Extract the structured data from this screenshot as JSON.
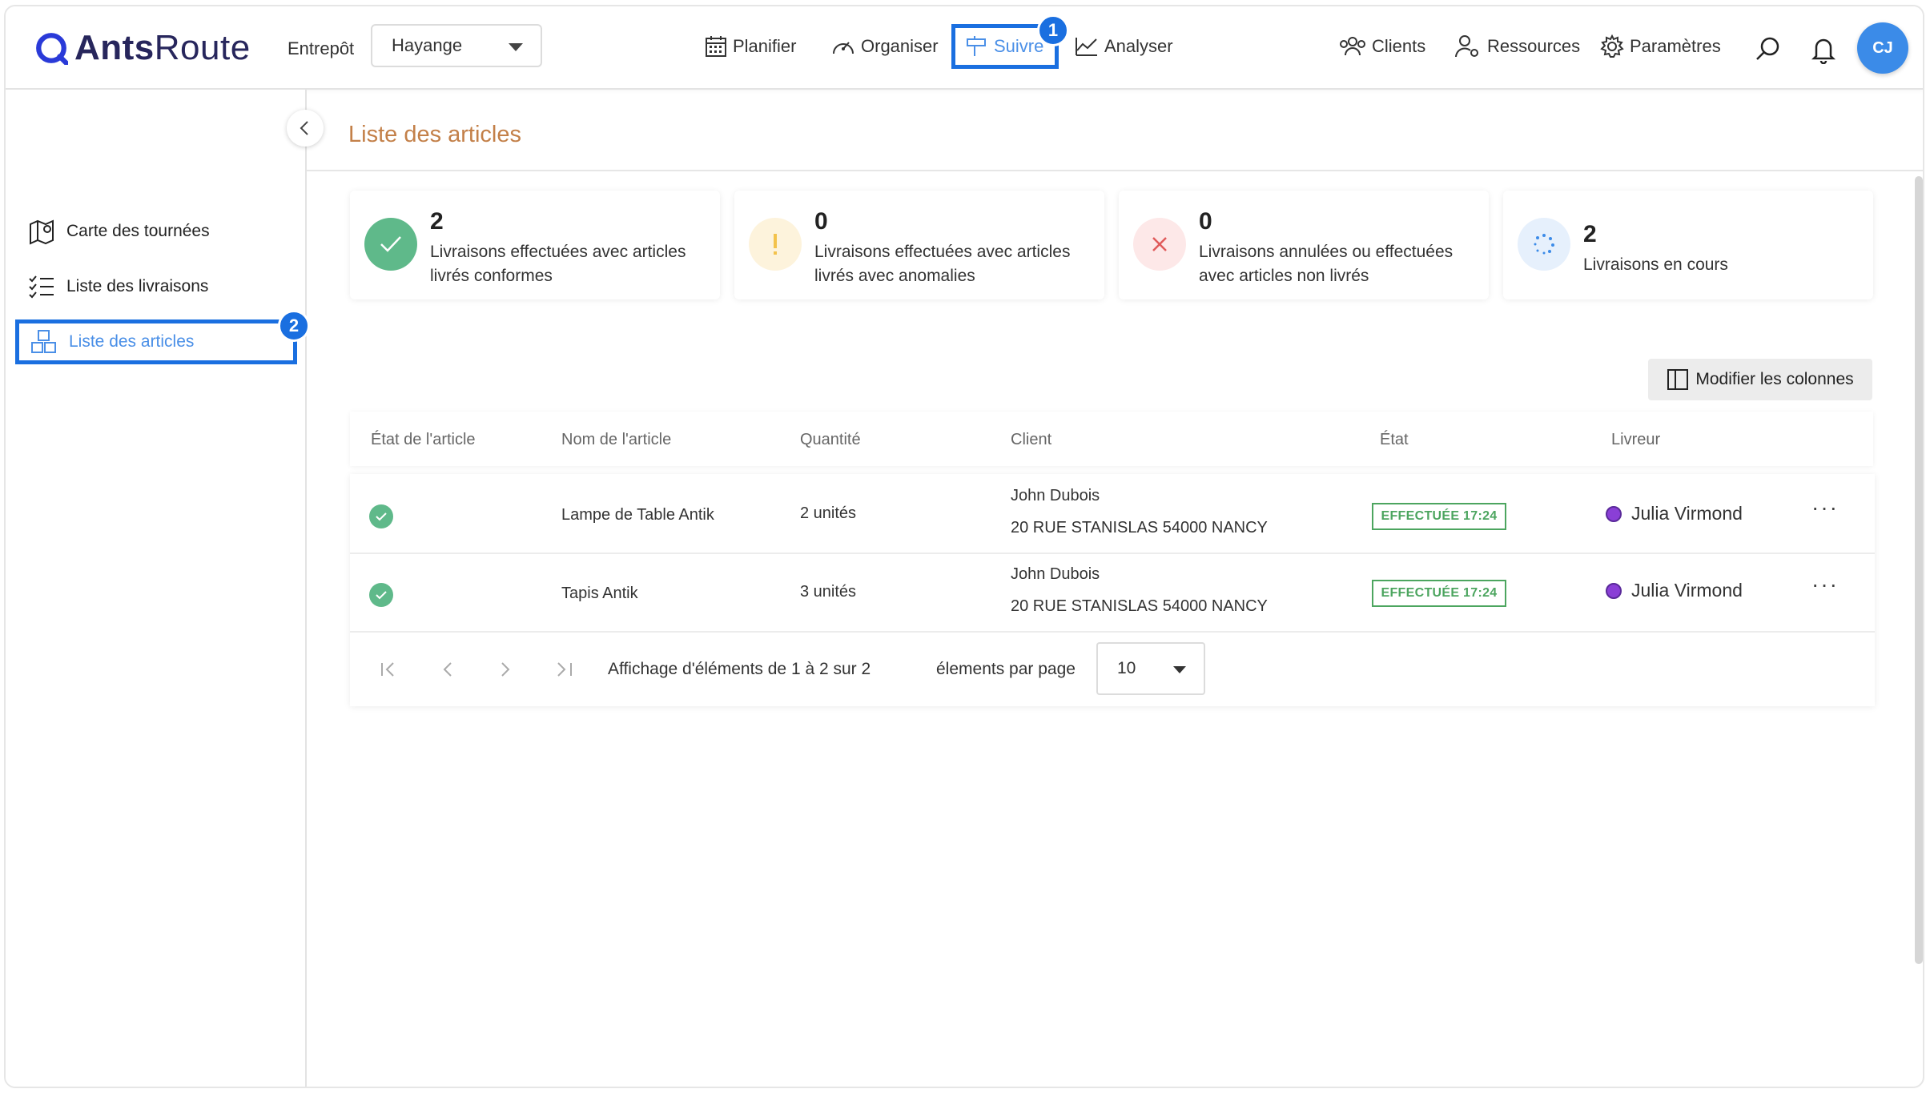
{
  "app": {
    "logo_bold": "Ants",
    "logo_light": "Route"
  },
  "header": {
    "warehouse_label": "Entrepôt",
    "warehouse_value": "Hayange",
    "nav": [
      {
        "label": "Planifier"
      },
      {
        "label": "Organiser"
      },
      {
        "label": "Suivre",
        "active": true,
        "step_badge": "1"
      },
      {
        "label": "Analyser"
      }
    ],
    "right_nav": [
      {
        "label": "Clients"
      },
      {
        "label": "Ressources"
      },
      {
        "label": "Paramètres"
      }
    ],
    "avatar_initials": "CJ"
  },
  "sidebar": {
    "items": [
      {
        "label": "Carte des tournées"
      },
      {
        "label": "Liste des livraisons"
      },
      {
        "label": "Liste des articles",
        "active": true,
        "step_badge": "2"
      }
    ]
  },
  "main": {
    "title": "Liste des articles",
    "stats": [
      {
        "value": "2",
        "label": "Livraisons effectuées avec articles livrés conformes",
        "color": "#5fb98a"
      },
      {
        "value": "0",
        "label": "Livraisons effectuées avec articles livrés avec anomalies",
        "color": "#f3c24b"
      },
      {
        "value": "0",
        "label": "Livraisons annulées ou effectuées avec articles non livrés",
        "color": "#e05a5a"
      },
      {
        "value": "2",
        "label": "Livraisons en cours",
        "color": "#3b8be8"
      }
    ],
    "modify_columns": "Modifier les colonnes",
    "table": {
      "columns": [
        "État de l'article",
        "Nom de l'article",
        "Quantité",
        "Client",
        "État",
        "Livreur"
      ],
      "rows": [
        {
          "item": "Lampe de Table Antik",
          "qty": "2 unités",
          "client": "John Dubois",
          "address": "20 RUE STANISLAS 54000 NANCY",
          "status": "EFFECTUÉE 17:24",
          "driver": "Julia Virmond"
        },
        {
          "item": "Tapis Antik",
          "qty": "3 unités",
          "client": "John Dubois",
          "address": "20 RUE STANISLAS 54000 NANCY",
          "status": "EFFECTUÉE 17:24",
          "driver": "Julia Virmond"
        }
      ]
    },
    "pagination": {
      "summary": "Affichage d'éléments de 1 à 2 sur 2",
      "per_page_label": "élements par page",
      "per_page_value": "10"
    }
  }
}
